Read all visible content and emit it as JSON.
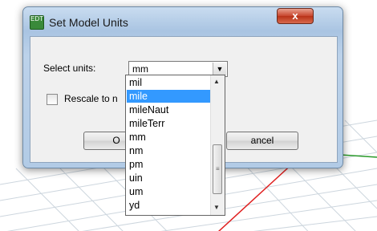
{
  "dialog": {
    "title": "Set Model Units",
    "icon_text": "EDT",
    "close_glyph": "x"
  },
  "form": {
    "select_label": "Select units:",
    "selected_unit": "mm",
    "rescale_label": "Rescale to n",
    "rescale_checked": false
  },
  "buttons": {
    "ok_label": "O",
    "cancel_label": "ancel"
  },
  "dropdown": {
    "options": [
      "mil",
      "mile",
      "mileNaut",
      "mileTerr",
      "mm",
      "nm",
      "pm",
      "uin",
      "um",
      "yd"
    ],
    "highlighted": "mile"
  },
  "icons": {
    "combo_arrow": "▼",
    "scroll_up": "▲",
    "scroll_down": "▼",
    "scroll_grip": "≡"
  },
  "colors": {
    "selection": "#3399ff",
    "close_button": "#c7452c",
    "grid_red_axis": "#e02020",
    "grid_green_axis": "#2a9a2a"
  }
}
